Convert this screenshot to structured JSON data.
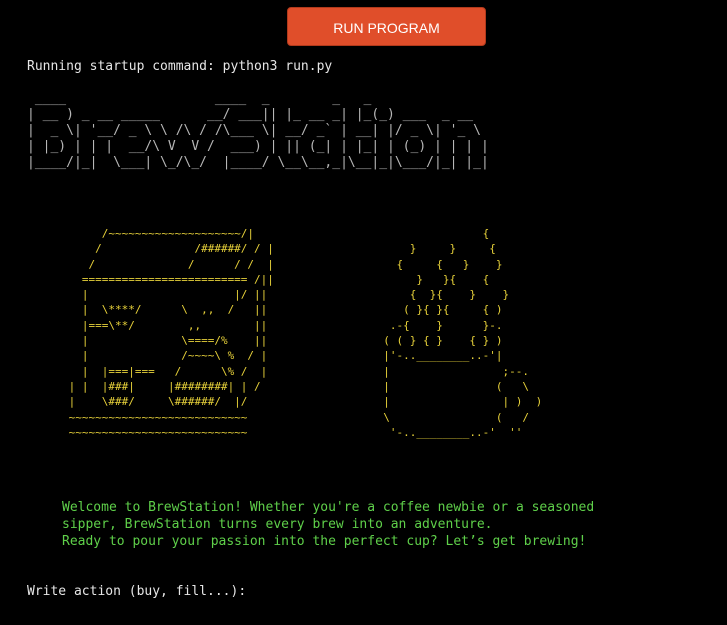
{
  "toolbar": {
    "run_label": "RUN PROGRAM",
    "run_color": "#e04e2a"
  },
  "terminal": {
    "startup_line": "Running startup command: python3 run.py",
    "banner": " ____                   ____  _        _   _             \n| __ ) _ __ _____      __/ ___|| |_ __ _| |_(_) ___  _ __  \n|  _ \\| '__/ _ \\ \\ /\\ / /\\___ \\| __/ _` | __| |/ _ \\| '_ \\ \n| |_) | | |  __/\\ V  V /  ___) | || (_| | |_| | (_) | | | |\n|____/|_|  \\___| \\_/\\_/  |____/ \\__\\__,_|\\__|_|\\___/|_| |_|",
    "machine_art": "      /~~~~~~~~~~~~~~~~~~~~/|\n     /              /######/ / |\n    /              /      / /  |\n   ========================= /||\n   |                      |/ ||\n   |  \\****/      \\  ,,  /   ||\n   |===\\**/        ,,        ||\n   |              \\====/%    ||\n   |              /~~~~\\ %  / |\n   |  |===|===   /      \\% /  |\n | |  |###|     |########| | /\n |    \\###/     \\######/  |/\n ~~~~~~~~~~~~~~~~~~~~~~~~~~~\n ~~~~~~~~~~~~~~~~~~~~~~~~~~~",
    "cup_art": "                 {\n      }     }     {\n    {     {   }    }\n       }   }{    {\n      {  }{    }    }\n     ( }{ }{     { )\n   .-{    }      }-.\n  ( ( } { }    { } )\n  |'-..________..-'|\n  |                 ;--.\n  |                (   \\\n  |                 | )  )\n  \\                (   /\n   '-..________..-'  ''",
    "welcome_lines": [
      "Welcome to BrewStation! Whether you're a coffee newbie or a seasoned",
      "sipper, BrewStation turns every brew into an adventure.",
      "Ready to pour your passion into the perfect cup? Let’s get brewing!"
    ],
    "prompt": "Write action (buy, fill...): ",
    "colors": {
      "art": "#e8d23a",
      "welcome": "#5fd04a",
      "text": "#e6e6e6",
      "banner": "#b7b7b7"
    }
  }
}
